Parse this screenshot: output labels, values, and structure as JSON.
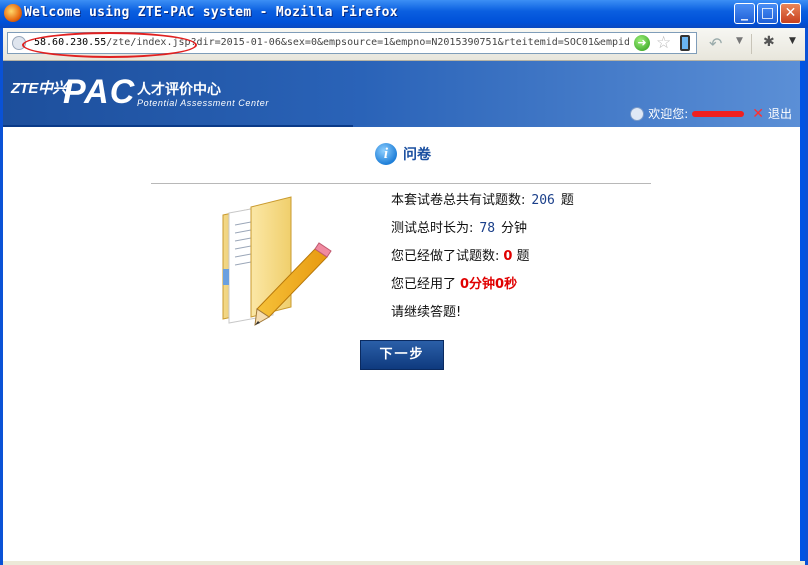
{
  "window": {
    "title": "Welcome using ZTE-PAC system - Mozilla Firefox",
    "controls": {
      "minimize": "_",
      "maximize": "□",
      "close": "✕"
    }
  },
  "navbar": {
    "url_host": "58.60.230.55",
    "url_rest": "/zte/index.jsp?dir=2015-01-06&sex=0&empsource=1&empno=N2015390751&rteitemid=SOC01&empid",
    "icons": [
      "back-arrow-icon",
      "go-icon",
      "bookmark-star-icon",
      "phone-icon",
      "addon-icon"
    ]
  },
  "banner": {
    "company_logo": "ZTE中兴",
    "product_logo": "PAC",
    "title_cn": "人才评价中心",
    "subtitle_en": "Potential  Assessment  Center",
    "welcome_label": "欢迎您:",
    "logout_label": "退出"
  },
  "panel": {
    "title": "问卷",
    "lines": [
      {
        "prefix": "本套试卷总共有试题数:",
        "value": "206",
        "suffix": "题"
      },
      {
        "prefix": "测试总时长为:",
        "value": "78",
        "suffix": "分钟"
      },
      {
        "prefix": "您已经做了试题数:",
        "value": "0",
        "suffix": "题"
      },
      {
        "prefix": "您已经用了",
        "value": "0分钟0秒",
        "suffix": ""
      },
      {
        "prefix": "请继续答题!",
        "value": "",
        "suffix": ""
      }
    ],
    "next_button": "下一步"
  },
  "colors": {
    "titlebar_blue": "#0a5fe0",
    "banner_blue": "#2a63b8",
    "number_blue": "#1a3f8a",
    "alert_red": "#e00000",
    "button_navy": "#0f3a7e"
  }
}
